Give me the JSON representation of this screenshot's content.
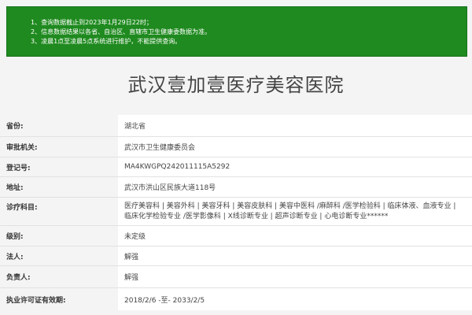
{
  "notice": {
    "lines": [
      "1、查询数据截止到2023年1月29日22时；",
      "2、信息数据结果以各省、自治区、直辖市卫生健康委数据为准。",
      "3、凌晨1点至凌晨5点系统进行维护，不能提供查询。"
    ],
    "bg_color": "#1f8a1f"
  },
  "title": "武汉壹加壹医疗美容医院",
  "fields": [
    {
      "label": "省份:",
      "value": "湖北省"
    },
    {
      "label": "审批机关:",
      "value": "武汉市卫生健康委员会"
    },
    {
      "label": "登记号:",
      "value": "MA4KWGPQ242011115A5292"
    },
    {
      "label": "地址:",
      "value": "武汉市洪山区民族大道118号"
    },
    {
      "label": "诊疗科目:",
      "value": "医疗美容科 | 美容外科 | 美容牙科 | 美容皮肤科 | 美容中医科 /麻醉科 /医学检验科 | 临床体液、血液专业 | 临床化学检验专业 /医学影像科 | X线诊断专业 | 超声诊断专业 | 心电诊断专业******"
    },
    {
      "label": "级别:",
      "value": "未定级"
    },
    {
      "label": "法人:",
      "value": "解强"
    },
    {
      "label": "负责人:",
      "value": "解强"
    },
    {
      "label": "执业许可证有效期:",
      "value": "2018/2/6 -至- 2033/2/5"
    }
  ]
}
